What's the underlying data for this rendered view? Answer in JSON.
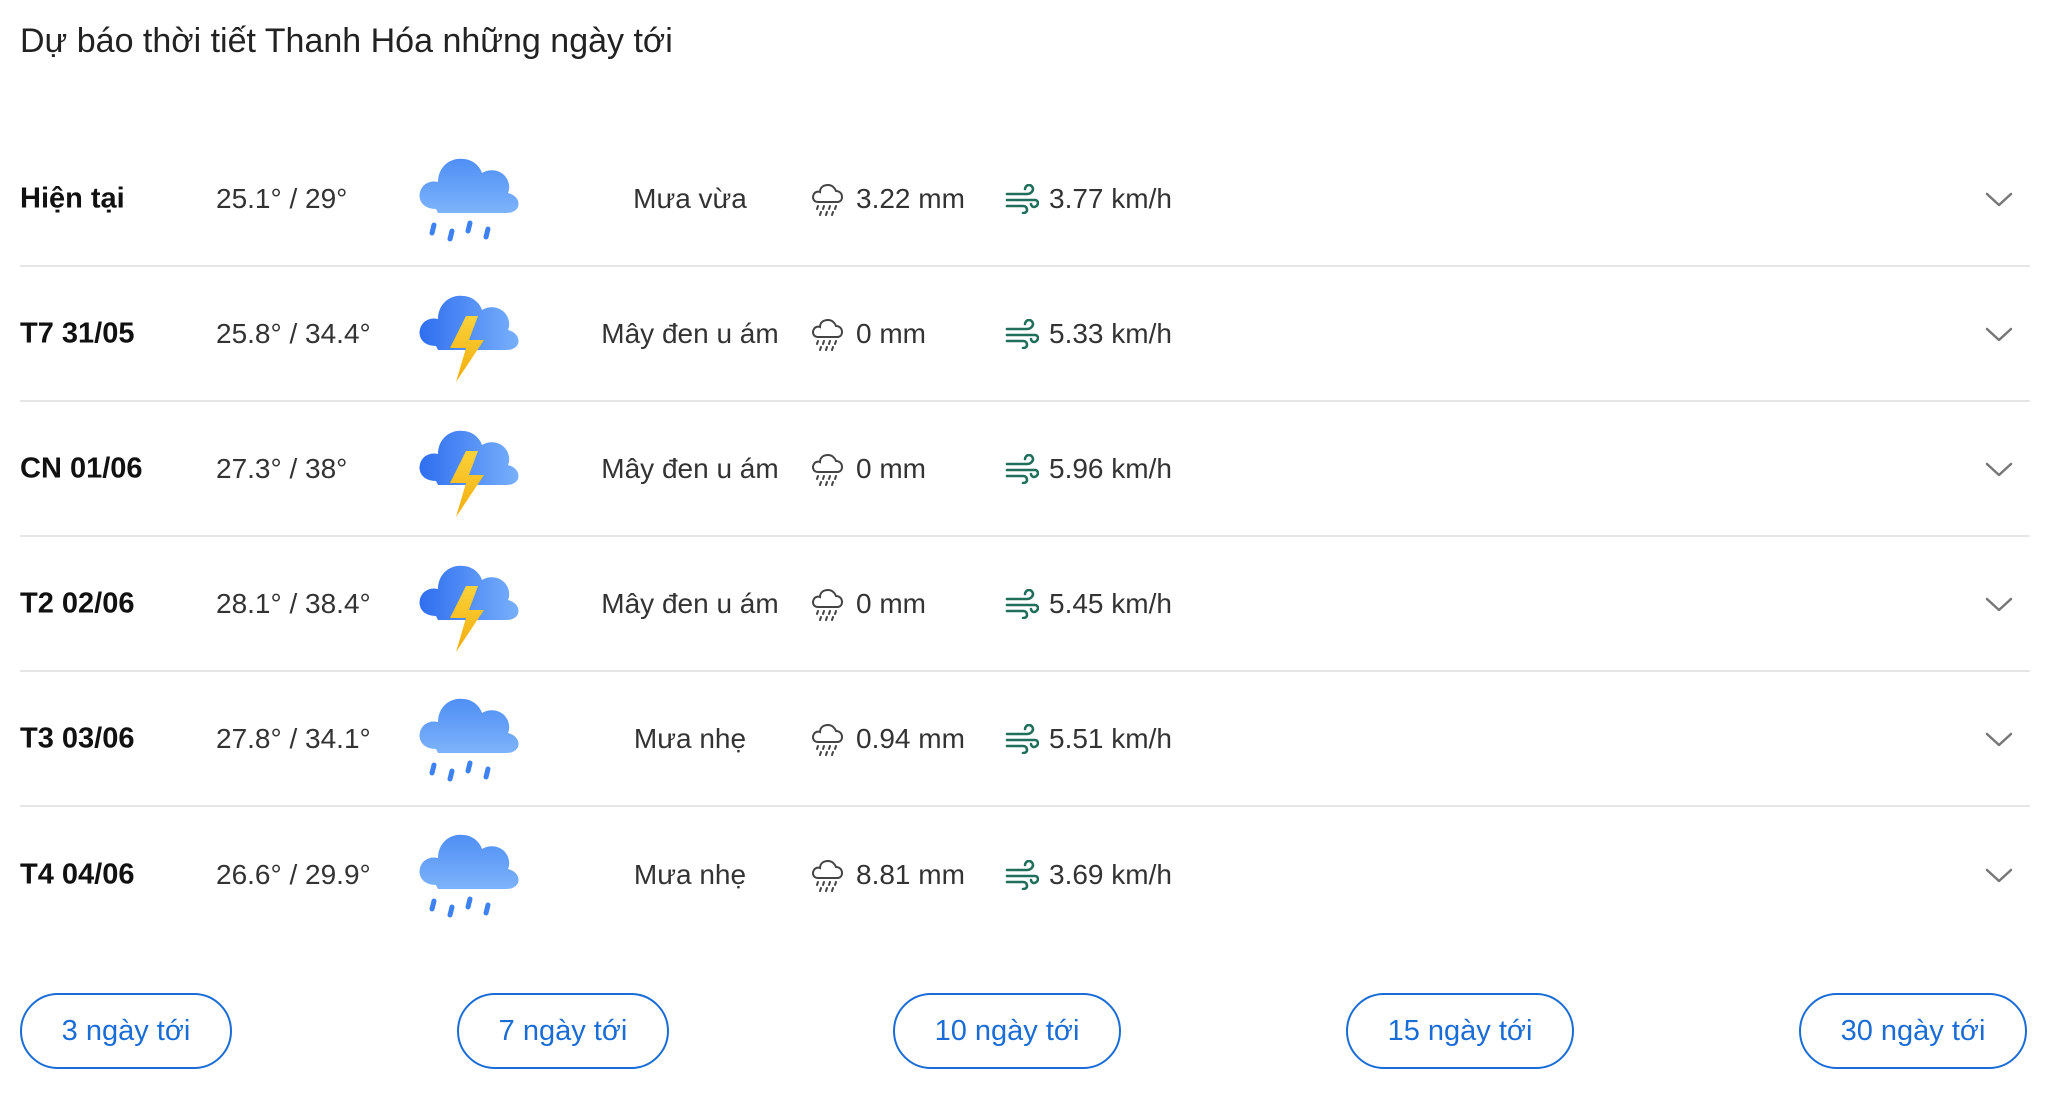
{
  "title": "Dự báo thời tiết Thanh Hóa những ngày tới",
  "rows": [
    {
      "day": "Hiện tại",
      "temp": "25.1° / 29°",
      "icon": "rain-icon",
      "condition": "Mưa vừa",
      "rain": "3.22 mm",
      "wind": "3.77 km/h"
    },
    {
      "day": "T7 31/05",
      "temp": "25.8° / 34.4°",
      "icon": "thunderstorm-icon",
      "condition": "Mây đen u ám",
      "rain": "0 mm",
      "wind": "5.33 km/h"
    },
    {
      "day": "CN 01/06",
      "temp": "27.3° / 38°",
      "icon": "thunderstorm-icon",
      "condition": "Mây đen u ám",
      "rain": "0 mm",
      "wind": "5.96 km/h"
    },
    {
      "day": "T2 02/06",
      "temp": "28.1° / 38.4°",
      "icon": "thunderstorm-icon",
      "condition": "Mây đen u ám",
      "rain": "0 mm",
      "wind": "5.45 km/h"
    },
    {
      "day": "T3 03/06",
      "temp": "27.8° / 34.1°",
      "icon": "rain-icon",
      "condition": "Mưa nhẹ",
      "rain": "0.94 mm",
      "wind": "5.51 km/h"
    },
    {
      "day": "T4 04/06",
      "temp": "26.6° / 29.9°",
      "icon": "rain-icon",
      "condition": "Mưa nhẹ",
      "rain": "8.81 mm",
      "wind": "3.69 km/h"
    }
  ],
  "buttons": [
    {
      "label": "3 ngày tới"
    },
    {
      "label": "7 ngày tới"
    },
    {
      "label": "10 ngày tới"
    },
    {
      "label": "15 ngày tới"
    },
    {
      "label": "30 ngày tới"
    }
  ],
  "colors": {
    "accent": "#1a6dd6",
    "cloud": "#5a9bf5",
    "bolt": "#f7c21a",
    "wind_icon": "#1f6f5c"
  }
}
